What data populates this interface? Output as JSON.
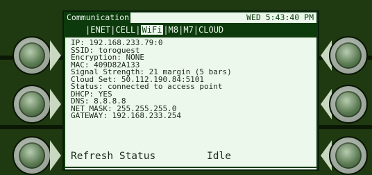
{
  "header": {
    "title": "Communication",
    "clock": "WED 5:43:40 PM"
  },
  "tabs": [
    {
      "label": "ENET",
      "active": false
    },
    {
      "label": "CELL",
      "active": false
    },
    {
      "label": "WiFi",
      "active": true
    },
    {
      "label": "M8",
      "active": false
    },
    {
      "label": "M7",
      "active": false
    },
    {
      "label": "CLOUD",
      "active": false
    }
  ],
  "wifi_info": {
    "ip": "IP: 192.168.233.79:0",
    "ssid": "SSID: toroguest",
    "encryption": "Encryption: NONE",
    "mac": "MAC: 409D82A133",
    "signal": "Signal Strength: 21 margin (5 bars)",
    "cloud_set": "Cloud Set: 50.112.190.84:5101",
    "status": "Status: connected to access point",
    "dhcp": "DHCP: YES",
    "dns": "DNS: 8.8.8.8",
    "net_mask": "NET MASK: 255.255.255.0",
    "gateway": "GATEWAY: 192.168.233.254"
  },
  "status_bar": {
    "action_label": "Refresh Status",
    "state": "Idle"
  },
  "colors": {
    "screen_bg": "#0d3a0d",
    "content_bg": "#ecf8ec",
    "bezel": "#1f3a10"
  },
  "icons": {
    "left_buttons": [
      "left-arrow-icon",
      "left-arrow-icon",
      "left-arrow-icon"
    ],
    "right_buttons": [
      "right-arrow-icon",
      "right-arrow-icon",
      "right-arrow-icon"
    ]
  }
}
